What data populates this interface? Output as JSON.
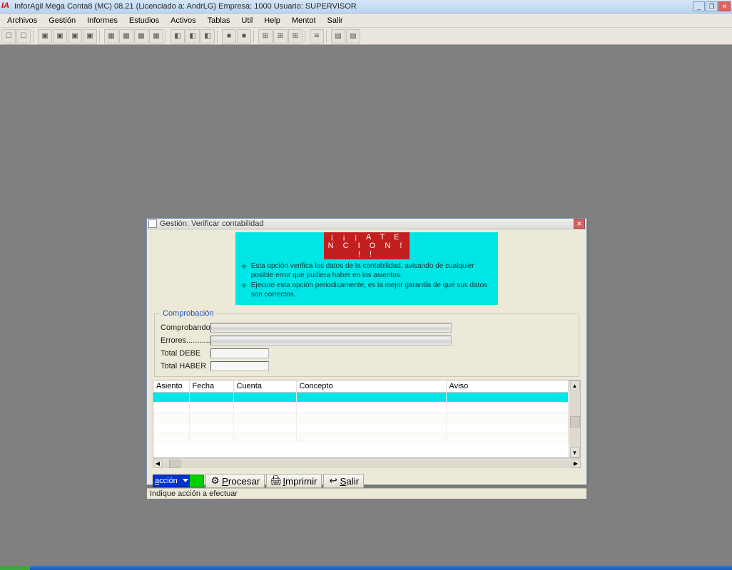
{
  "main_title": "InforAgil Mega Conta8 (MC) 08.21  (Licenciado a: AndrLG)  Empresa: 1000  Usuario: SUPERVISOR",
  "menus": [
    "Archivos",
    "Gestión",
    "Informes",
    "Estudios",
    "Activos",
    "Tablas",
    "Util",
    "Help",
    "Mentot",
    "Salir"
  ],
  "dialog": {
    "title": "Gestión: Verificar contabilidad",
    "attention": {
      "header": "¡ ¡ ¡  A T E N C I O N  ! ! !",
      "line1": "Esta opción verifica los datos de la contabilidad, avisando de cualquier posible error que pudiera haber en los asientos.",
      "line2": "Ejecute esta opción periodicamente, es la mejor garantía de que sus datos son correctos."
    },
    "groupbox_title": "Comprobación",
    "labels": {
      "comprobando": "Comprobando..",
      "errores": "Errores............",
      "total_debe": "Total DEBE",
      "total_haber": "Total HABER"
    },
    "grid_headers": {
      "asiento": "Asiento",
      "fecha": "Fecha",
      "cuenta": "Cuenta",
      "concepto": "Concepto",
      "aviso": "Aviso"
    },
    "buttons": {
      "accion": "acción",
      "procesar": "Procesar",
      "imprimir": "Imprimir",
      "salir": "Salir"
    },
    "status": "Indique acción a efectuar"
  }
}
